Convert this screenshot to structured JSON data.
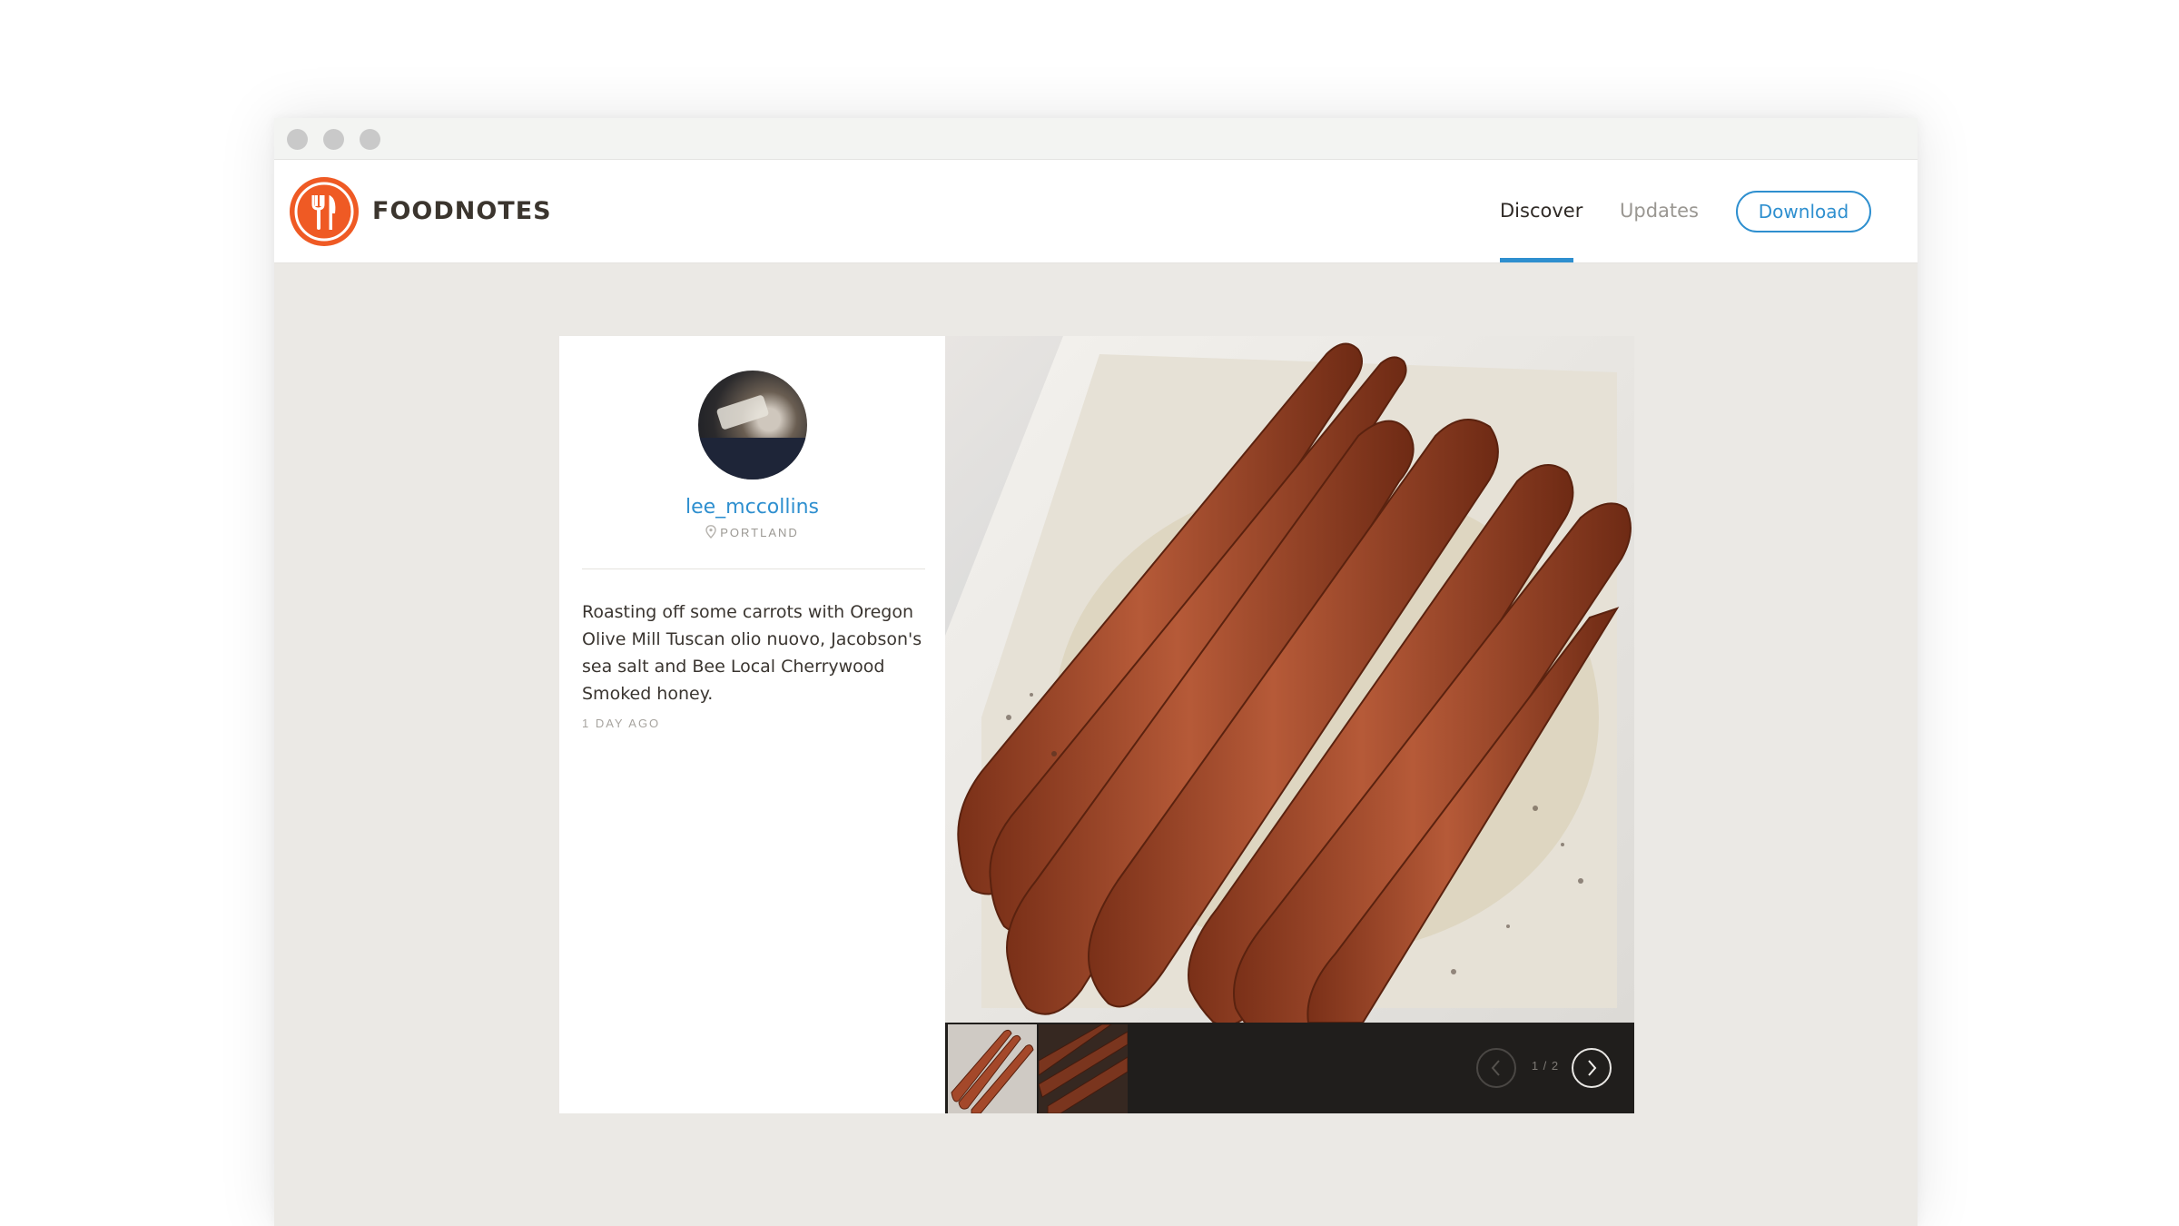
{
  "app": {
    "brand": "FOODNOTES",
    "brand_color": "#ef5a24",
    "accent_color": "#2e8fcf"
  },
  "nav": {
    "items": [
      {
        "label": "Discover",
        "active": true
      },
      {
        "label": "Updates",
        "active": false
      }
    ],
    "download_label": "Download"
  },
  "post": {
    "username": "lee_mccollins",
    "location": "PORTLAND",
    "caption": "Roasting off some carrots with Oregon Olive Mill Tuscan olio nuovo, Jacobson's sea salt and Bee Local Cherrywood Smoked honey.",
    "timestamp": "1 DAY AGO",
    "image_subject": "roasted carrots in a white baking dish",
    "gallery": {
      "pager_text": "1 / 2",
      "current": 1,
      "total": 2
    }
  },
  "icons": {
    "logo": "fork-knife-icon",
    "location": "map-pin-icon",
    "prev": "chevron-left-icon",
    "next": "chevron-right-icon"
  }
}
